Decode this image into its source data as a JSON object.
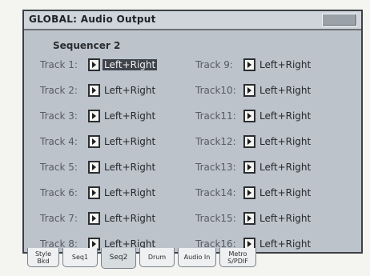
{
  "window": {
    "title": "GLOBAL: Audio Output"
  },
  "section": {
    "label": "Sequencer 2"
  },
  "tracks": [
    {
      "label": "Track 1:",
      "value": "Left+Right",
      "selected": true
    },
    {
      "label": "Track 2:",
      "value": "Left+Right"
    },
    {
      "label": "Track 3:",
      "value": "Left+Right"
    },
    {
      "label": "Track 4:",
      "value": "Left+Right"
    },
    {
      "label": "Track 5:",
      "value": "Left+Right"
    },
    {
      "label": "Track 6:",
      "value": "Left+Right"
    },
    {
      "label": "Track 7:",
      "value": "Left+Right"
    },
    {
      "label": "Track 8:",
      "value": "Left+Right"
    },
    {
      "label": "Track 9:",
      "value": "Left+Right"
    },
    {
      "label": "Track10:",
      "value": "Left+Right"
    },
    {
      "label": "Track11:",
      "value": "Left+Right"
    },
    {
      "label": "Track12:",
      "value": "Left+Right"
    },
    {
      "label": "Track13:",
      "value": "Left+Right"
    },
    {
      "label": "Track14:",
      "value": "Left+Right"
    },
    {
      "label": "Track15:",
      "value": "Left+Right"
    },
    {
      "label": "Track16:",
      "value": "Left+Right"
    }
  ],
  "tabs": [
    {
      "label": "Style\nBkd"
    },
    {
      "label": "Seq1"
    },
    {
      "label": "Seq2",
      "active": true
    },
    {
      "label": "Drum"
    },
    {
      "label": "Audio In"
    },
    {
      "label": "Metro\nS/PDIF"
    }
  ],
  "colors": {
    "panel_bg": "#bcc3cb",
    "selected_bg": "#3f434a",
    "label_text": "#575c63"
  }
}
